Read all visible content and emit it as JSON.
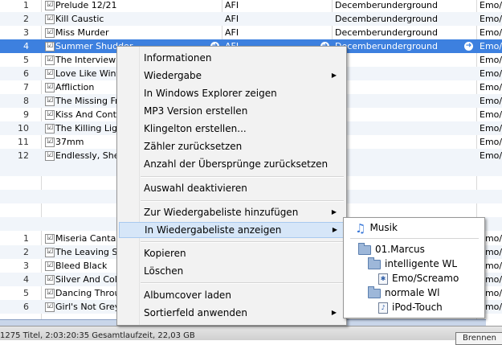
{
  "tracks_top": [
    {
      "num": "1",
      "name": "Prelude 12/21",
      "artist": "AFI",
      "album": "Decemberunderground",
      "genre": "Emo/S"
    },
    {
      "num": "2",
      "name": "Kill Caustic",
      "artist": "AFI",
      "album": "Decemberunderground",
      "genre": "Emo/S"
    },
    {
      "num": "3",
      "name": "Miss Murder",
      "artist": "AFI",
      "album": "Decemberunderground",
      "genre": "Emo/S"
    },
    {
      "num": "4",
      "name": "Summer Shudder",
      "artist": "AFI",
      "album": "Decemberunderground",
      "genre": "Emo/S"
    },
    {
      "num": "5",
      "name": "The Interview",
      "artist": "",
      "album": "",
      "genre": "Emo/S"
    },
    {
      "num": "6",
      "name": "Love Like Winter",
      "artist": "",
      "album": "",
      "genre": "Emo/S"
    },
    {
      "num": "7",
      "name": "Affliction",
      "artist": "",
      "album": "",
      "genre": "Emo/S"
    },
    {
      "num": "8",
      "name": "The Missing Frame",
      "artist": "",
      "album": "",
      "genre": "Emo/S"
    },
    {
      "num": "9",
      "name": "Kiss And Control",
      "artist": "",
      "album": "",
      "genre": "Emo/S"
    },
    {
      "num": "10",
      "name": "The Killing Lights",
      "artist": "",
      "album": "",
      "genre": "Emo/S"
    },
    {
      "num": "11",
      "name": "37mm",
      "artist": "",
      "album": "",
      "genre": "Emo/S"
    },
    {
      "num": "12",
      "name": "Endlessly, She Said",
      "artist": "",
      "album": "",
      "genre": "Emo/S"
    }
  ],
  "tracks_bottom": [
    {
      "num": "1",
      "name": "Miseria Cantare",
      "genre": "Emo/S"
    },
    {
      "num": "2",
      "name": "The Leaving Song",
      "genre": "Emo/S"
    },
    {
      "num": "3",
      "name": "Bleed Black",
      "genre": "Emo/S"
    },
    {
      "num": "4",
      "name": "Silver And Cold",
      "genre": "Emo/S"
    },
    {
      "num": "5",
      "name": "Dancing Through Sunday",
      "genre": "Emo/S"
    },
    {
      "num": "6",
      "name": "Girl's Not Grey",
      "genre": "Emo/S"
    }
  ],
  "check_mark": "☑",
  "context_menu": {
    "items": [
      {
        "label": "Informationen",
        "submenu": false
      },
      {
        "label": "Wiedergabe",
        "submenu": true
      },
      {
        "label": "In Windows Explorer zeigen",
        "submenu": false
      },
      {
        "label": "MP3 Version erstellen",
        "submenu": false
      },
      {
        "label": "Klingelton erstellen...",
        "submenu": false
      },
      {
        "label": "Zähler zurücksetzen",
        "submenu": false
      },
      {
        "label": "Anzahl der Übersprünge zurücksetzen",
        "submenu": false
      },
      {
        "label": "Auswahl deaktivieren",
        "submenu": false
      },
      {
        "label": "Zur Wiedergabeliste hinzufügen",
        "submenu": true
      },
      {
        "label": "In Wiedergabeliste anzeigen",
        "submenu": true
      },
      {
        "label": "Kopieren",
        "submenu": false
      },
      {
        "label": "Löschen",
        "submenu": false
      },
      {
        "label": "Albumcover laden",
        "submenu": false
      },
      {
        "label": "Sortierfeld anwenden",
        "submenu": true
      }
    ],
    "submenu_arrow": "▶"
  },
  "playlist_submenu": {
    "items": [
      {
        "label": "Musik",
        "icon": "music-note-icon"
      },
      {
        "label": "01.Marcus",
        "icon": "folder-icon"
      },
      {
        "label": "intelligente WL",
        "icon": "folder-icon"
      },
      {
        "label": "Emo/Screamo",
        "icon": "smart-playlist-icon"
      },
      {
        "label": "normale Wl",
        "icon": "folder-icon"
      },
      {
        "label": "iPod-Touch",
        "icon": "playlist-icon"
      }
    ]
  },
  "status": {
    "summary": "1275 Titel, 2:03:20:35 Gesamtlaufzeit, 22,03 GB",
    "button": "Brennen"
  },
  "colors": {
    "selection": "#3d80df",
    "menu_highlight": "#d6e6f8"
  }
}
